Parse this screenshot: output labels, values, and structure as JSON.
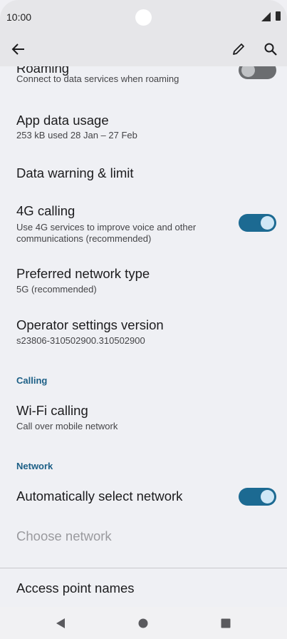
{
  "status_bar": {
    "time": "10:00"
  },
  "toolbar": {
    "back_icon": "arrow-left-icon",
    "edit_icon": "pencil-icon",
    "search_icon": "search-icon"
  },
  "settings": {
    "roaming": {
      "title": "Roaming",
      "summary": "Connect to data services when roaming",
      "toggle": "off"
    },
    "app_data_usage": {
      "title": "App data usage",
      "summary": "253 kB used 28 Jan – 27 Feb"
    },
    "data_warning": {
      "title": "Data warning & limit"
    },
    "calling_4g": {
      "title": "4G calling",
      "summary": "Use 4G services to improve voice and other communications (recommended)",
      "toggle": "on"
    },
    "preferred_network": {
      "title": "Preferred network type",
      "summary": "5G (recommended)"
    },
    "operator_version": {
      "title": "Operator settings version",
      "summary": "s23806-310502900.310502900"
    },
    "calling_header": "Calling",
    "wifi_calling": {
      "title": "Wi-Fi calling",
      "summary": "Call over mobile network"
    },
    "network_header": "Network",
    "auto_network": {
      "title": "Automatically select network",
      "toggle": "on"
    },
    "choose_network": {
      "title": "Choose network",
      "disabled": true
    },
    "apn": {
      "title": "Access point names"
    }
  },
  "colors": {
    "accent": "#1c6a92",
    "section_header": "#1c5f86",
    "background": "#eff0f4"
  }
}
